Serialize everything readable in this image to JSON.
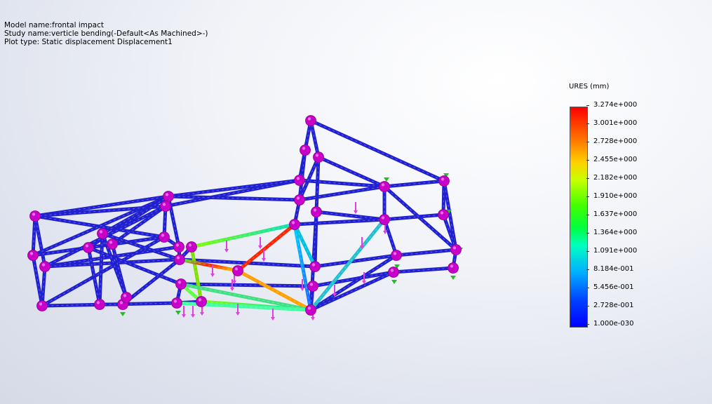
{
  "header": {
    "model_name": "Model name:frontal impact",
    "study_name": "Study name:verticle bending(-Default<As Machined>-)",
    "plot_type": "Plot type: Static displacement Displacement1"
  },
  "legend": {
    "title": "URES (mm)",
    "labels": [
      "3.274e+000",
      "3.001e+000",
      "2.728e+000",
      "2.455e+000",
      "2.182e+000",
      "1.910e+000",
      "1.637e+000",
      "1.364e+000",
      "1.091e+000",
      "8.184e-001",
      "5.456e-001",
      "2.728e-001",
      "1.000e-030"
    ]
  },
  "colors": {
    "frame_tube": "#2020d0",
    "node": "#c800c8",
    "load_arrow": "#e040e0",
    "fixture_arrow": "#20c020"
  }
}
